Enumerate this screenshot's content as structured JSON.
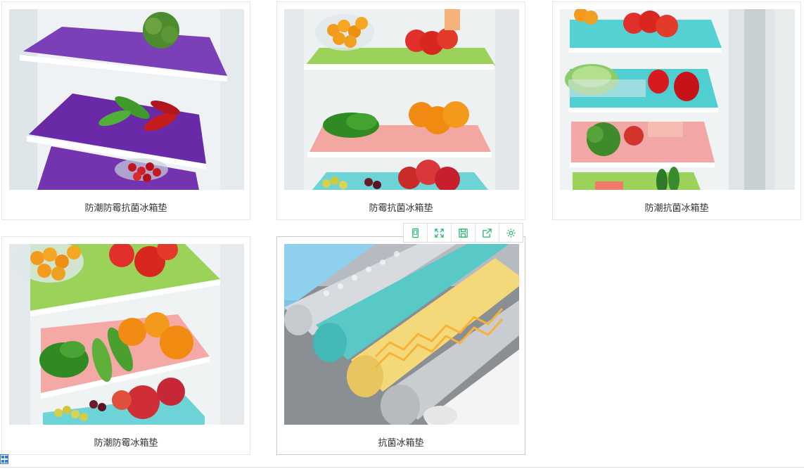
{
  "products": [
    {
      "caption": "防潮防霉抗菌冰箱垫",
      "image": "fridge-purple-mats"
    },
    {
      "caption": "防霉抗菌冰箱垫",
      "image": "fridge-green-pink-mats"
    },
    {
      "caption": "防潮抗菌冰箱垫",
      "image": "fridge-blue-pink-mats"
    },
    {
      "caption": "防潮防霉冰箱垫",
      "image": "fridge-green-pink-blue-mats"
    },
    {
      "caption": "抗菌冰箱垫",
      "image": "rolled-mats"
    }
  ],
  "toolbar": {
    "icons": [
      "mobile-icon",
      "expand-icon",
      "save-icon",
      "share-icon",
      "settings-icon"
    ],
    "color": "#2bb673"
  }
}
